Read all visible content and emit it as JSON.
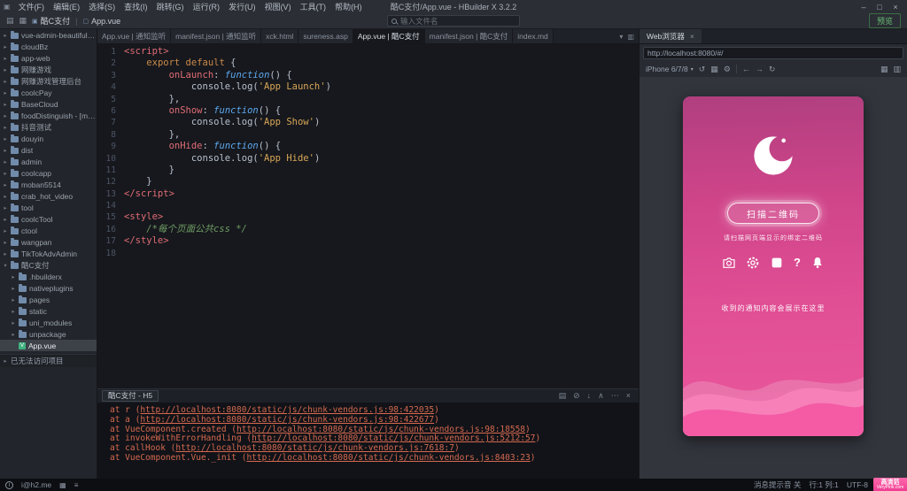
{
  "window": {
    "title": "酷C支付/App.vue - HBuilder X 3.2.2",
    "menus": [
      "文件(F)",
      "编辑(E)",
      "选择(S)",
      "查找(I)",
      "跳转(G)",
      "运行(R)",
      "发行(U)",
      "视图(V)",
      "工具(T)",
      "帮助(H)"
    ],
    "minimize": "–",
    "maximize": "□",
    "close": "×"
  },
  "toolbar": {
    "project_chip": "酷C支付",
    "file_chip": "App.vue",
    "search_placeholder": "输入文件名",
    "preview_label": "预览"
  },
  "sidebar": {
    "items": [
      {
        "label": "vue-admin-beautiful通...",
        "type": "folder"
      },
      {
        "label": "cloudBz",
        "type": "folder"
      },
      {
        "label": "app-web",
        "type": "folder"
      },
      {
        "label": "网赚游戏",
        "type": "folder"
      },
      {
        "label": "网赚游戏管理后台",
        "type": "folder"
      },
      {
        "label": "coolcPay",
        "type": "folder"
      },
      {
        "label": "BaseCloud",
        "type": "folder"
      },
      {
        "label": "foodDistinguish - [master]",
        "type": "folder"
      },
      {
        "label": "抖音测试",
        "type": "folder"
      },
      {
        "label": "douyin",
        "type": "folder"
      },
      {
        "label": "dist",
        "type": "folder"
      },
      {
        "label": "admin",
        "type": "folder"
      },
      {
        "label": "coolcapp",
        "type": "folder"
      },
      {
        "label": "moban5514",
        "type": "folder"
      },
      {
        "label": "crab_hot_video",
        "type": "folder"
      },
      {
        "label": "tool",
        "type": "folder"
      },
      {
        "label": "coolcTool",
        "type": "folder"
      },
      {
        "label": "ctool",
        "type": "folder"
      },
      {
        "label": "wangpan",
        "type": "folder"
      },
      {
        "label": "TikTokAdvAdmin",
        "type": "folder"
      },
      {
        "label": "酷C支付",
        "type": "folder",
        "expanded": true
      },
      {
        "label": ".hbuilderx",
        "type": "folder",
        "depth": 1
      },
      {
        "label": "nativeplugins",
        "type": "folder",
        "depth": 1
      },
      {
        "label": "pages",
        "type": "folder",
        "depth": 1
      },
      {
        "label": "static",
        "type": "folder",
        "depth": 1
      },
      {
        "label": "uni_modules",
        "type": "folder",
        "depth": 1
      },
      {
        "label": "unpackage",
        "type": "folder",
        "depth": 1
      },
      {
        "label": "App.vue",
        "type": "file",
        "depth": 1,
        "selected": true
      }
    ],
    "footer": "已无法访问项目"
  },
  "tabs": {
    "items": [
      {
        "label": "App.vue | 通知监听"
      },
      {
        "label": "manifest.json | 通知监听"
      },
      {
        "label": "xck.html"
      },
      {
        "label": "sureness.asp"
      },
      {
        "label": "App.vue | 酷C支付",
        "active": true
      },
      {
        "label": "manifest.json | 酷C支付"
      },
      {
        "label": "index.md"
      }
    ]
  },
  "editor": {
    "lines": [
      {
        "n": "1",
        "tk": [
          {
            "c": "tag",
            "t": "<script>"
          }
        ]
      },
      {
        "n": "2",
        "tk": [
          {
            "c": "pl",
            "t": "    "
          },
          {
            "c": "kw",
            "t": "export default"
          },
          {
            "c": "pl",
            "t": " {"
          }
        ]
      },
      {
        "n": "3",
        "tk": [
          {
            "c": "pl",
            "t": "        "
          },
          {
            "c": "prop",
            "t": "onLaunch"
          },
          {
            "c": "pl",
            "t": ": "
          },
          {
            "c": "fn",
            "t": "function"
          },
          {
            "c": "pl",
            "t": "() {"
          }
        ]
      },
      {
        "n": "4",
        "tk": [
          {
            "c": "pl",
            "t": "            console.log("
          },
          {
            "c": "str",
            "t": "'App Launch'"
          },
          {
            "c": "pl",
            "t": ")"
          }
        ]
      },
      {
        "n": "5",
        "tk": [
          {
            "c": "pl",
            "t": "        },"
          }
        ]
      },
      {
        "n": "6",
        "tk": [
          {
            "c": "pl",
            "t": "        "
          },
          {
            "c": "prop",
            "t": "onShow"
          },
          {
            "c": "pl",
            "t": ": "
          },
          {
            "c": "fn",
            "t": "function"
          },
          {
            "c": "pl",
            "t": "() {"
          }
        ]
      },
      {
        "n": "7",
        "tk": [
          {
            "c": "pl",
            "t": "            console.log("
          },
          {
            "c": "str",
            "t": "'App Show'"
          },
          {
            "c": "pl",
            "t": ")"
          }
        ]
      },
      {
        "n": "8",
        "tk": [
          {
            "c": "pl",
            "t": "        },"
          }
        ]
      },
      {
        "n": "9",
        "tk": [
          {
            "c": "pl",
            "t": "        "
          },
          {
            "c": "prop",
            "t": "onHide"
          },
          {
            "c": "pl",
            "t": ": "
          },
          {
            "c": "fn",
            "t": "function"
          },
          {
            "c": "pl",
            "t": "() {"
          }
        ]
      },
      {
        "n": "10",
        "tk": [
          {
            "c": "pl",
            "t": "            console.log("
          },
          {
            "c": "str",
            "t": "'App Hide'"
          },
          {
            "c": "pl",
            "t": ")"
          }
        ]
      },
      {
        "n": "11",
        "tk": [
          {
            "c": "pl",
            "t": "        }"
          }
        ]
      },
      {
        "n": "12",
        "tk": [
          {
            "c": "pl",
            "t": "    }"
          }
        ]
      },
      {
        "n": "13",
        "tk": [
          {
            "c": "tag",
            "t": "</script>"
          }
        ]
      },
      {
        "n": "14",
        "tk": []
      },
      {
        "n": "15",
        "tk": [
          {
            "c": "tag",
            "t": "<style>"
          }
        ]
      },
      {
        "n": "16",
        "tk": [
          {
            "c": "pl",
            "t": "    "
          },
          {
            "c": "cmt",
            "t": "/*每个页面公共css */"
          }
        ]
      },
      {
        "n": "17",
        "tk": [
          {
            "c": "tag",
            "t": "</style>"
          }
        ]
      },
      {
        "n": "18",
        "tk": []
      }
    ]
  },
  "console": {
    "tab": "酷C支付 - H5",
    "lines": [
      {
        "fn": "r",
        "url": "http://localhost:8080/static/js/chunk-vendors.js:98:422035"
      },
      {
        "fn": "a",
        "url": "http://localhost:8080/static/js/chunk-vendors.js:98:422677"
      },
      {
        "fn": "VueComponent.created",
        "url": "http://localhost:8080/static/js/chunk-vendors.js:98:18558"
      },
      {
        "fn": "invokeWithErrorHandling",
        "url": "http://localhost:8080/static/js/chunk-vendors.js:5212:57"
      },
      {
        "fn": "callHook",
        "url": "http://localhost:8080/static/js/chunk-vendors.js:7618:7"
      },
      {
        "fn": "VueComponent.Vue._init",
        "url": "http://localhost:8080/static/js/chunk-vendors.js:8403:23"
      }
    ]
  },
  "browser": {
    "tab": "Web浏览器",
    "close": "×",
    "url": "http://localhost:8080/#/",
    "device": "iPhone 6/7/8",
    "phone": {
      "scan_button": "扫描二维码",
      "scan_hint": "请扫描网页端显示的绑定二维码",
      "notice": "收到的通知内容会展示在这里",
      "icon_names": [
        "camera-icon",
        "gear-icon",
        "box-icon",
        "help-icon",
        "bell-icon"
      ],
      "bg_top": "#b03f80",
      "bg_bottom": "#ea579c"
    }
  },
  "statusbar": {
    "left_text": "i@h2.me",
    "sound": "消息提示音 关",
    "cursor": "行:1 列:1",
    "encoding": "UTF-8",
    "watermark_line1": "高清范",
    "watermark_line2": "VeryPink.com"
  },
  "colors": {
    "accent_pink": "#e04e94",
    "accent_green": "#68bb72",
    "console_text": "#d5694f"
  },
  "icons": {
    "app_logo": "▣",
    "project": "▣",
    "file": "▢",
    "chev_right": "▸",
    "chev_down": "▾",
    "dropdown": "▾",
    "back": "←",
    "forward": "→",
    "refresh": "↻",
    "rotate": "↺",
    "qr": "▦",
    "gear": "⚙",
    "grid": "▦",
    "lines": "≡",
    "panel": "▤",
    "clear": "⊘",
    "down": "↓",
    "collapse": "∧",
    "dots": "⋯",
    "split": "▥",
    "close": "×"
  }
}
